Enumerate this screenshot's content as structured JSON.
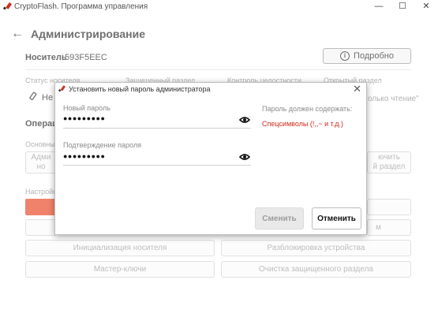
{
  "window": {
    "title": "CryptoFlash. Программа управления",
    "minimize": "—",
    "maximize": "☐",
    "close": "✕"
  },
  "header": {
    "back_icon": "←",
    "title": "Администрирование"
  },
  "carrier": {
    "label": "Носитель",
    "id": "593F5EEC",
    "details_button": "Подробно",
    "info_glyph": "i"
  },
  "status": {
    "carrier_status_label": "Статус носителя",
    "carrier_status_value": "Не",
    "protected_partition_label": "Защищенный раздел",
    "integrity_label": "Контроль целостности",
    "open_partition_label": "Открытый раздел",
    "open_partition_value": "олько чтение\""
  },
  "operations": {
    "title": "Операц",
    "basic_label": "Основны",
    "left_btn_partial": "Адми\nно",
    "right_btn_partial": "ючить\nй раздел",
    "settings_label": "Настройк",
    "hidden_btn_partial": "м",
    "init_button": "Инициализация носителя",
    "unlock_button": "Разблокировка устройства",
    "master_keys_button": "Мастер-ключи",
    "clear_button": "Очистка защищенного раздела"
  },
  "modal": {
    "title": "Установить новый пароль администратора",
    "close_icon": "✕",
    "new_password_label": "Новый пароль",
    "new_password_value": "●●●●●●●●●",
    "confirm_password_label": "Подтверждение пароля",
    "confirm_password_value": "●●●●●●●●●",
    "requirements_label": "Пароль должен содержать:",
    "requirement_special": "Спецсимволы (!,,~ и т.д.)",
    "change_button": "Сменить",
    "cancel_button": "Отменить"
  },
  "colors": {
    "accent": "#e8401c",
    "requirement_red": "#d0281c"
  }
}
